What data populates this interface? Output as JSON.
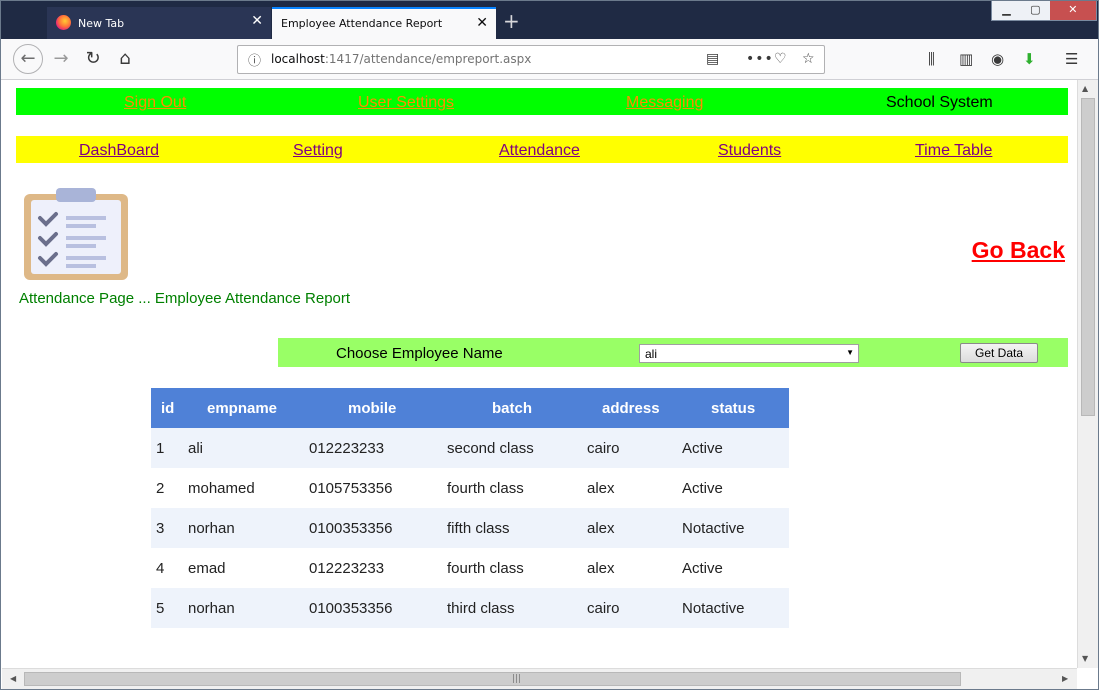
{
  "browser": {
    "tabs": [
      {
        "label": "New Tab"
      },
      {
        "label": "Employee Attendance Report"
      }
    ],
    "url_host": "localhost",
    "url_rest": ":1417/attendance/empreport.aspx",
    "new_tab_symbol": "+",
    "close_symbol": "✕"
  },
  "topbar": {
    "sign_out": "Sign Out",
    "user_settings": "User Settings",
    "messaging": "Messaging",
    "brand": "School System"
  },
  "menu": {
    "items": [
      "DashBoard",
      "Setting",
      "Attendance",
      "Students",
      "Time Table"
    ]
  },
  "header": {
    "go_back": "Go Back",
    "caption": "Attendance Page ... Employee Attendance Report"
  },
  "filter": {
    "label": "Choose Employee Name",
    "selected": "ali",
    "button": "Get Data"
  },
  "table": {
    "columns": [
      "id",
      "empname",
      "mobile",
      "batch",
      "address",
      "status"
    ],
    "rows": [
      [
        "1",
        "ali",
        "012223233",
        "second class",
        "cairo",
        "Active"
      ],
      [
        "2",
        "mohamed",
        "0105753356",
        "fourth class",
        "alex",
        "Active"
      ],
      [
        "3",
        "norhan",
        "0100353356",
        "fifth class",
        "alex",
        "Notactive"
      ],
      [
        "4",
        "emad",
        "012223233",
        "fourth class",
        "alex",
        "Active"
      ],
      [
        "5",
        "norhan",
        "0100353356",
        "third class",
        "cairo",
        "Notactive"
      ]
    ]
  },
  "colors": {
    "topbar_bg": "#00ff00",
    "menubar_bg": "#ffff00",
    "filter_bg": "#99ff66",
    "table_header_bg": "#4f81d7",
    "go_back": "#ff0000",
    "caption": "#008000"
  },
  "icons": [
    "firefox-icon",
    "back-arrow-icon",
    "forward-arrow-icon",
    "reload-icon",
    "home-icon",
    "info-icon",
    "reader-view-icon",
    "more-icon",
    "pocket-icon",
    "bookmark-star-icon",
    "library-icon",
    "sidebar-icon",
    "account-icon",
    "download-icon",
    "menu-icon",
    "clipboard-checklist-icon"
  ]
}
